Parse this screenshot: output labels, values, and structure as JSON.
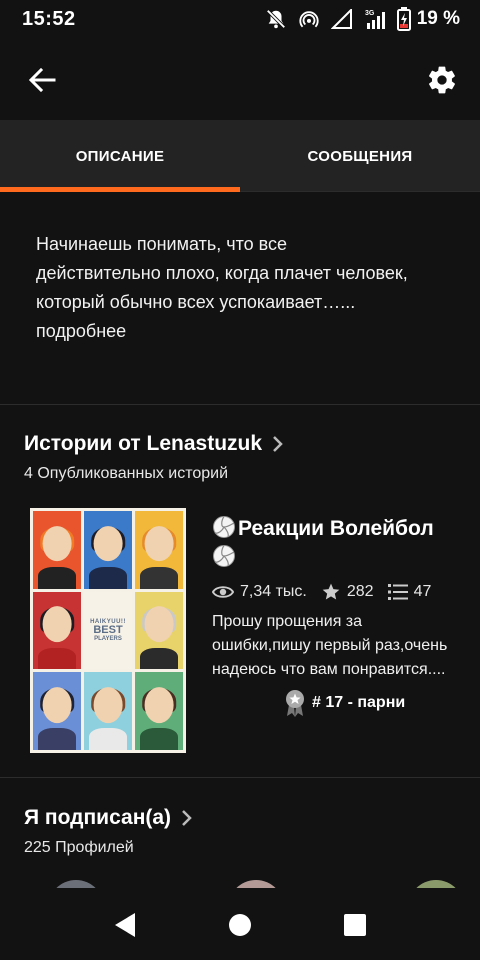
{
  "status_bar": {
    "time": "15:52",
    "battery_percent": "19 %",
    "network_label": "3G",
    "icons": [
      "bell-off-icon",
      "hotspot-icon",
      "signal-icon",
      "signal-3g-icon",
      "battery-charging-icon"
    ]
  },
  "app_bar": {
    "back_icon": "arrow-left-icon",
    "settings_icon": "gear-icon"
  },
  "tabs": [
    {
      "label": "ОПИСАНИЕ",
      "active": true
    },
    {
      "label": "СООБЩЕНИЯ",
      "active": false
    }
  ],
  "accent_color": "#ff6a1f",
  "description": {
    "text": "Начинаешь понимать, что все действительно плохо, когда плачет человек, который обычно всех успокаивает…...",
    "more_label": "подробнее"
  },
  "stories_section": {
    "title": "Истории от Lenastuzuk",
    "subtitle": "4 Опубликованных историй",
    "story": {
      "title": "Реакции Волейбол",
      "cover_text": [
        "HAIKYUU!!",
        "BEST",
        "PLAYERS"
      ],
      "reads": "7,34 тыс.",
      "votes": "282",
      "parts": "47",
      "description_lines": [
        "Прошу прощения за",
        "ошибки,пишу первый раз,очень",
        "надеюсь что вам понравится...."
      ],
      "rank": "# 17 - парни"
    }
  },
  "following_section": {
    "title": "Я подписан(а)",
    "subtitle": "225 Профилей"
  },
  "nav_bar": {
    "buttons": [
      "back-triangle-icon",
      "home-circle-icon",
      "recents-square-icon"
    ]
  }
}
